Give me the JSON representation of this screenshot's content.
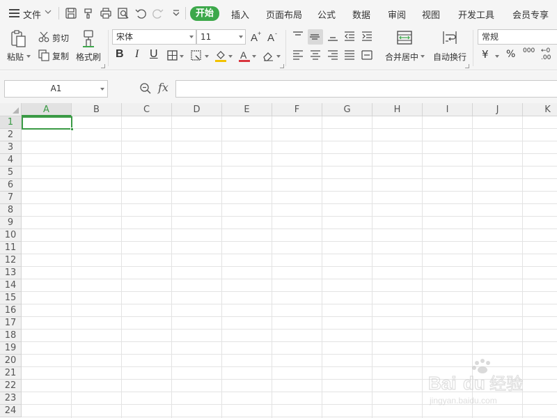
{
  "menubar": {
    "file_label": "文件",
    "tabs": [
      {
        "label": "开始",
        "active": true
      },
      {
        "label": "插入"
      },
      {
        "label": "页面布局"
      },
      {
        "label": "公式"
      },
      {
        "label": "数据"
      },
      {
        "label": "审阅"
      },
      {
        "label": "视图"
      },
      {
        "label": "开发工具"
      },
      {
        "label": "会员专享"
      }
    ],
    "quick_access_icons": [
      "save-icon",
      "format-painter-icon",
      "print-icon",
      "print-preview-icon",
      "undo-icon",
      "redo-icon",
      "customize-chevron-icon"
    ]
  },
  "ribbon": {
    "clipboard": {
      "paste_label": "粘贴",
      "cut_label": "剪切",
      "copy_label": "复制",
      "format_painter_label": "格式刷"
    },
    "font": {
      "font_name": "宋体",
      "font_size": "11",
      "bold": "B",
      "italic": "I",
      "underline": "U",
      "font_color_accent": "#d9363e",
      "fill_color_accent": "#f2c200"
    },
    "alignment": {
      "merge_center_label": "合并居中",
      "wrap_text_label": "自动换行"
    },
    "number": {
      "format_value": "常规",
      "currency_symbol": "¥",
      "percent_symbol": "%",
      "thousands_label": "000",
      "decimal_label": "←0 .00"
    }
  },
  "formula_bar": {
    "name_box_value": "A1",
    "fx_label": "fx",
    "formula_value": ""
  },
  "grid": {
    "columns": [
      "A",
      "B",
      "C",
      "D",
      "E",
      "F",
      "G",
      "H",
      "I",
      "J",
      "K"
    ],
    "rows": [
      "1",
      "2",
      "3",
      "4",
      "5",
      "6",
      "7",
      "8",
      "9",
      "10",
      "11",
      "12",
      "13",
      "14",
      "15",
      "16",
      "17",
      "18",
      "19",
      "20",
      "21",
      "22",
      "23",
      "24"
    ],
    "selected_column": "A",
    "selected_row": "1"
  },
  "watermark": {
    "brand": "Bai",
    "brand_suffix": "du",
    "cn_text": "经验",
    "url": "jingyan.baidu.com"
  },
  "colors": {
    "accent_green": "#3ca84a",
    "ribbon_bg": "#f5f5f5",
    "gridline": "#e3e3e3"
  }
}
